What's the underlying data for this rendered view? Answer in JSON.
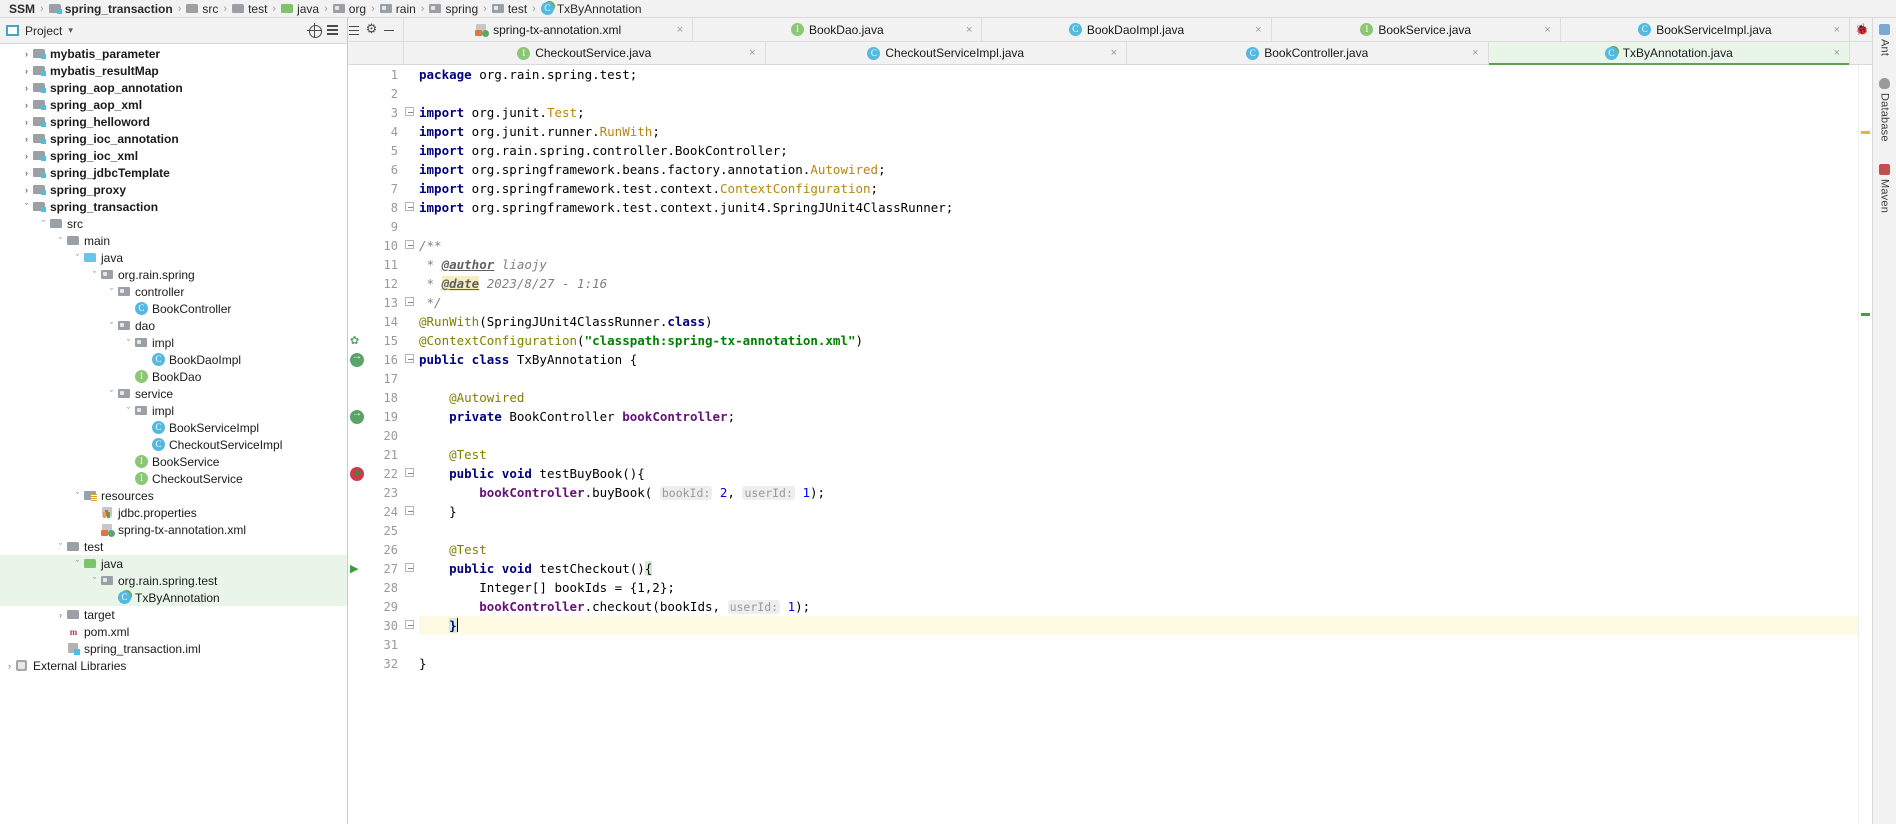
{
  "breadcrumb": [
    {
      "label": "SSM",
      "icon": "none",
      "bold": true
    },
    {
      "label": "spring_transaction",
      "icon": "module-icon",
      "bold": true
    },
    {
      "label": "src",
      "icon": "folder-icon",
      "bold": false
    },
    {
      "label": "test",
      "icon": "folder-icon",
      "bold": false
    },
    {
      "label": "java",
      "icon": "folder-green-icon",
      "bold": false
    },
    {
      "label": "org",
      "icon": "package-icon",
      "bold": false
    },
    {
      "label": "rain",
      "icon": "package-icon",
      "bold": false
    },
    {
      "label": "spring",
      "icon": "package-icon",
      "bold": false
    },
    {
      "label": "test",
      "icon": "package-icon",
      "bold": false
    },
    {
      "label": "TxByAnnotation",
      "icon": "class-test-icon",
      "bold": false
    }
  ],
  "sidebar": {
    "title": "Project",
    "caret": "▾",
    "buttons": [
      {
        "name": "locate-in-tree-button",
        "icon": "locate-icon"
      },
      {
        "name": "collapse-all-button",
        "icon": "collapse-all-icon"
      }
    ],
    "tree": [
      {
        "label": "mybatis_parameter",
        "depth": 1,
        "arrow": "›",
        "icon": "module-icon",
        "bold": true,
        "state": "none"
      },
      {
        "label": "mybatis_resultMap",
        "depth": 1,
        "arrow": "›",
        "icon": "module-icon",
        "bold": true,
        "state": "none"
      },
      {
        "label": "spring_aop_annotation",
        "depth": 1,
        "arrow": "›",
        "icon": "module-icon",
        "bold": true,
        "state": "none"
      },
      {
        "label": "spring_aop_xml",
        "depth": 1,
        "arrow": "›",
        "icon": "module-icon",
        "bold": true,
        "state": "none"
      },
      {
        "label": "spring_helloword",
        "depth": 1,
        "arrow": "›",
        "icon": "module-icon",
        "bold": true,
        "state": "none"
      },
      {
        "label": "spring_ioc_annotation",
        "depth": 1,
        "arrow": "›",
        "icon": "module-icon",
        "bold": true,
        "state": "none"
      },
      {
        "label": "spring_ioc_xml",
        "depth": 1,
        "arrow": "›",
        "icon": "module-icon",
        "bold": true,
        "state": "none"
      },
      {
        "label": "spring_jdbcTemplate",
        "depth": 1,
        "arrow": "›",
        "icon": "module-icon",
        "bold": true,
        "state": "none"
      },
      {
        "label": "spring_proxy",
        "depth": 1,
        "arrow": "›",
        "icon": "module-icon",
        "bold": true,
        "state": "none"
      },
      {
        "label": "spring_transaction",
        "depth": 1,
        "arrow": "ˇ",
        "icon": "module-icon",
        "bold": true,
        "state": "none"
      },
      {
        "label": "src",
        "depth": 2,
        "arrow": "ˇ",
        "icon": "folder-icon",
        "bold": false,
        "state": "none"
      },
      {
        "label": "main",
        "depth": 3,
        "arrow": "ˇ",
        "icon": "folder-icon",
        "bold": false,
        "state": "none"
      },
      {
        "label": "java",
        "depth": 4,
        "arrow": "ˇ",
        "icon": "folder-blue-icon",
        "bold": false,
        "state": "none"
      },
      {
        "label": "org.rain.spring",
        "depth": 5,
        "arrow": "ˇ",
        "icon": "package-icon",
        "bold": false,
        "state": "none"
      },
      {
        "label": "controller",
        "depth": 6,
        "arrow": "ˇ",
        "icon": "package-icon",
        "bold": false,
        "state": "none"
      },
      {
        "label": "BookController",
        "depth": 7,
        "arrow": "",
        "icon": "class-icon",
        "bold": false,
        "state": "none"
      },
      {
        "label": "dao",
        "depth": 6,
        "arrow": "ˇ",
        "icon": "package-icon",
        "bold": false,
        "state": "none"
      },
      {
        "label": "impl",
        "depth": 7,
        "arrow": "ˇ",
        "icon": "package-icon",
        "bold": false,
        "state": "none"
      },
      {
        "label": "BookDaoImpl",
        "depth": 8,
        "arrow": "",
        "icon": "class-icon",
        "bold": false,
        "state": "none"
      },
      {
        "label": "BookDao",
        "depth": 7,
        "arrow": "",
        "icon": "interface-icon",
        "bold": false,
        "state": "none"
      },
      {
        "label": "service",
        "depth": 6,
        "arrow": "ˇ",
        "icon": "package-icon",
        "bold": false,
        "state": "none"
      },
      {
        "label": "impl",
        "depth": 7,
        "arrow": "ˇ",
        "icon": "package-icon",
        "bold": false,
        "state": "none"
      },
      {
        "label": "BookServiceImpl",
        "depth": 8,
        "arrow": "",
        "icon": "class-icon",
        "bold": false,
        "state": "none"
      },
      {
        "label": "CheckoutServiceImpl",
        "depth": 8,
        "arrow": "",
        "icon": "class-icon",
        "bold": false,
        "state": "none"
      },
      {
        "label": "BookService",
        "depth": 7,
        "arrow": "",
        "icon": "interface-icon",
        "bold": false,
        "state": "none"
      },
      {
        "label": "CheckoutService",
        "depth": 7,
        "arrow": "",
        "icon": "interface-icon",
        "bold": false,
        "state": "none"
      },
      {
        "label": "resources",
        "depth": 4,
        "arrow": "ˇ",
        "icon": "resources-icon",
        "bold": false,
        "state": "none"
      },
      {
        "label": "jdbc.properties",
        "depth": 5,
        "arrow": "",
        "icon": "properties-icon",
        "bold": false,
        "state": "none"
      },
      {
        "label": "spring-tx-annotation.xml",
        "depth": 5,
        "arrow": "",
        "icon": "xml-icon",
        "bold": false,
        "state": "none"
      },
      {
        "label": "test",
        "depth": 3,
        "arrow": "ˇ",
        "icon": "folder-icon",
        "bold": false,
        "state": "none"
      },
      {
        "label": "java",
        "depth": 4,
        "arrow": "ˇ",
        "icon": "folder-green-icon",
        "bold": false,
        "state": "green"
      },
      {
        "label": "org.rain.spring.test",
        "depth": 5,
        "arrow": "ˇ",
        "icon": "package-icon",
        "bold": false,
        "state": "green"
      },
      {
        "label": "TxByAnnotation",
        "depth": 6,
        "arrow": "",
        "icon": "class-test-icon",
        "bold": false,
        "state": "green"
      },
      {
        "label": "target",
        "depth": 3,
        "arrow": "›",
        "icon": "folder-icon",
        "bold": false,
        "state": "none"
      },
      {
        "label": "pom.xml",
        "depth": 3,
        "arrow": "",
        "icon": "pom-icon",
        "bold": false,
        "state": "none"
      },
      {
        "label": "spring_transaction.iml",
        "depth": 3,
        "arrow": "",
        "icon": "iml-icon",
        "bold": false,
        "state": "none"
      },
      {
        "label": "External Libraries",
        "depth": 0,
        "arrow": "›",
        "icon": "library-icon",
        "bold": false,
        "state": "none"
      }
    ]
  },
  "editor": {
    "toolbar": [
      {
        "name": "collapse-icon"
      },
      {
        "name": "gear-icon"
      },
      {
        "name": "minimize-icon"
      }
    ],
    "tab_rows": [
      [
        {
          "label": "spring-tx-annotation.xml",
          "icon": "xml-icon",
          "active": false,
          "close": "×"
        },
        {
          "label": "BookDao.java",
          "icon": "interface-icon",
          "active": false,
          "close": "×"
        },
        {
          "label": "BookDaoImpl.java",
          "icon": "class-icon",
          "active": false,
          "close": "×"
        },
        {
          "label": "BookService.java",
          "icon": "interface-icon",
          "active": false,
          "close": "×"
        },
        {
          "label": "BookServiceImpl.java",
          "icon": "class-icon",
          "active": false,
          "close": "×"
        }
      ],
      [
        {
          "label": "CheckoutService.java",
          "icon": "interface-icon",
          "active": false,
          "close": "×"
        },
        {
          "label": "CheckoutServiceImpl.java",
          "icon": "class-icon",
          "active": false,
          "close": "×"
        },
        {
          "label": "BookController.java",
          "icon": "class-icon",
          "active": false,
          "close": "×"
        },
        {
          "label": "TxByAnnotation.java",
          "icon": "class-test-icon",
          "active": true,
          "close": "×"
        }
      ]
    ],
    "line_numbers": [
      1,
      2,
      3,
      4,
      5,
      6,
      7,
      8,
      9,
      10,
      11,
      12,
      13,
      14,
      15,
      16,
      17,
      18,
      19,
      20,
      21,
      22,
      23,
      24,
      25,
      26,
      27,
      28,
      29,
      30,
      31,
      32
    ],
    "highlighted_line": 30,
    "gutter_marks": [
      {
        "line": 15,
        "name": "context-config-marker",
        "kind": "ctx"
      },
      {
        "line": 16,
        "name": "spring-bean-marker",
        "kind": "bean"
      },
      {
        "line": 19,
        "name": "autowired-bean-marker",
        "kind": "bean"
      },
      {
        "line": 22,
        "name": "run-test-failed-marker",
        "kind": "testfail"
      },
      {
        "line": 27,
        "name": "run-test-marker",
        "kind": "run"
      }
    ],
    "fold_marks": [
      3,
      8,
      10,
      13,
      16,
      22,
      24,
      27,
      30
    ],
    "code": {
      "l1": "package org.rain.spring.test;",
      "l3": "import org.junit.Test;",
      "l4": "import org.junit.runner.RunWith;",
      "l5": "import org.rain.spring.controller.BookController;",
      "l6": "import org.springframework.beans.factory.annotation.Autowired;",
      "l7": "import org.springframework.test.context.ContextConfiguration;",
      "l8": "import org.springframework.test.context.junit4.SpringJUnit4ClassRunner;",
      "l10": "/**",
      "l11_star": "*",
      "l11_tag": "@author",
      "l11_val": "liaojy",
      "l12_star": "*",
      "l12_tag": "@date",
      "l12_val": "2023/8/27 - 1:16",
      "l13": "*/",
      "l14_ann": "@RunWith",
      "l14_arg": "SpringJUnit4ClassRunner",
      "l14_class": "class",
      "l15_ann": "@ContextConfiguration",
      "l15_str": "\"classpath:spring-tx-annotation.xml\"",
      "l16_mods": "public class",
      "l16_name": "TxByAnnotation {",
      "l18": "@Autowired",
      "l19_kw": "private",
      "l19_type": "BookController",
      "l19_field": "bookController",
      "l21": "@Test",
      "l22_kw": "public void",
      "l22_name": "testBuyBook(){",
      "l23_var": "bookController",
      "l23_call": ".buyBook(",
      "l23_hint1": "bookId:",
      "l23_num1": "2",
      "l23_hint2": "userId:",
      "l23_num2": "1",
      "l24": "}",
      "l26": "@Test",
      "l27_kw": "public void",
      "l27_name": "testCheckout(){",
      "l28_type": "Integer[]",
      "l28_rest": "bookIds = {1,2};",
      "l29_var": "bookController",
      "l29_call": ".checkout(bookIds,",
      "l29_hint": "userId:",
      "l29_num": "1",
      "l30": "}",
      "l32": "}"
    }
  },
  "rightbar": {
    "tabs": [
      {
        "label": "Ant",
        "icon": "ant-icon"
      },
      {
        "label": "Database",
        "icon": "database-icon"
      },
      {
        "label": "Maven",
        "icon": "maven-icon"
      }
    ]
  },
  "colors": {
    "accent_green": "#5fa052",
    "selection_green": "#eaf5ea",
    "chrome": "#f2f2f2",
    "keyword": "#000080",
    "annotation": "#808000",
    "string": "#008000",
    "field": "#660e7a",
    "highlight_line": "#fffae3"
  }
}
